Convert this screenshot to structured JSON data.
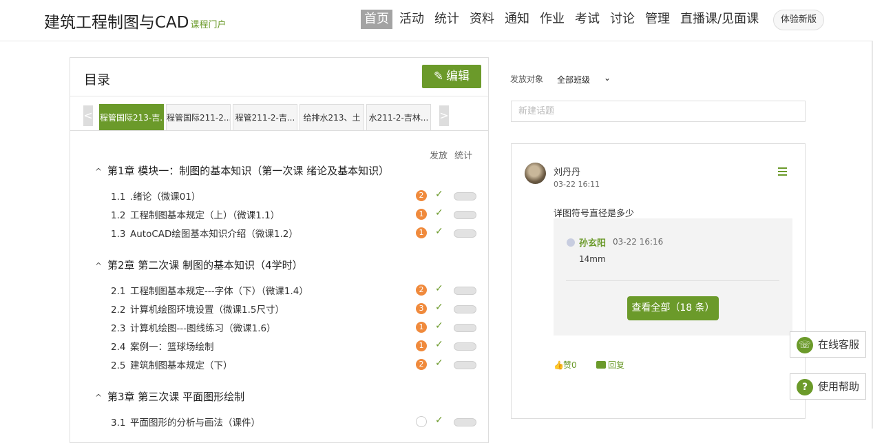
{
  "header": {
    "site_title": "建筑工程制图与CAD",
    "site_subtitle": "课程门户",
    "nav": [
      "首页",
      "活动",
      "统计",
      "资料",
      "通知",
      "作业",
      "考试",
      "讨论",
      "管理",
      "直播课/见面课"
    ],
    "active_nav": 0,
    "new_version_label": "体验新版"
  },
  "toc": {
    "title": "目录",
    "edit_label": "编辑",
    "tab_prev": "<",
    "tab_next": ">",
    "class_tabs": [
      "程管国际213-吉...",
      "程管国际211-2...",
      "程管211-2-吉...",
      "给排水213、土",
      "水211-2-吉林..."
    ],
    "col_publish": "发放",
    "col_stats": "统计",
    "chapters": [
      {
        "title": "第1章 模块一：制图的基本知识（第一次课 绪论及基本知识）",
        "lessons": [
          {
            "num": "1.1",
            "title": ".绪论（微课01）",
            "badge": "2"
          },
          {
            "num": "1.2",
            "title": "工程制图基本规定（上）（微课1.1）",
            "badge": "1"
          },
          {
            "num": "1.3",
            "title": "AutoCAD绘图基本知识介绍（微课1.2）",
            "badge": "1"
          }
        ]
      },
      {
        "title": "第2章 第二次课 制图的基本知识（4学时）",
        "lessons": [
          {
            "num": "2.1",
            "title": "工程制图基本规定---字体（下）（微课1.4）",
            "badge": "2"
          },
          {
            "num": "2.2",
            "title": "计算机绘图环境设置（微课1.5尺寸）",
            "badge": "3"
          },
          {
            "num": "2.3",
            "title": "计算机绘图---图线练习（微课1.6）",
            "badge": "1"
          },
          {
            "num": "2.4",
            "title": "案例一：篮球场绘制",
            "badge": "1"
          },
          {
            "num": "2.5",
            "title": "建筑制图基本规定（下）",
            "badge": "2"
          }
        ]
      },
      {
        "title": "第3章 第三次课 平面图形绘制",
        "lessons": [
          {
            "num": "3.1",
            "title": "平面图形的分析与画法（课件）",
            "badge": ""
          }
        ]
      }
    ]
  },
  "discussion": {
    "target_label": "发放对象",
    "target_value": "全部班级",
    "topic_placeholder": "新建话题",
    "post": {
      "author": "刘丹丹",
      "time": "03-22 16:11",
      "content": "详图符号直径是多少",
      "reply": {
        "author": "孙玄阳",
        "time": "03-22 16:16",
        "content": "14mm"
      },
      "view_all_label": "查看全部（18 条）",
      "like_label": "赞0",
      "reply_label": "回复"
    }
  },
  "float_buttons": {
    "service_label": "在线客服",
    "help_label": "使用帮助"
  }
}
